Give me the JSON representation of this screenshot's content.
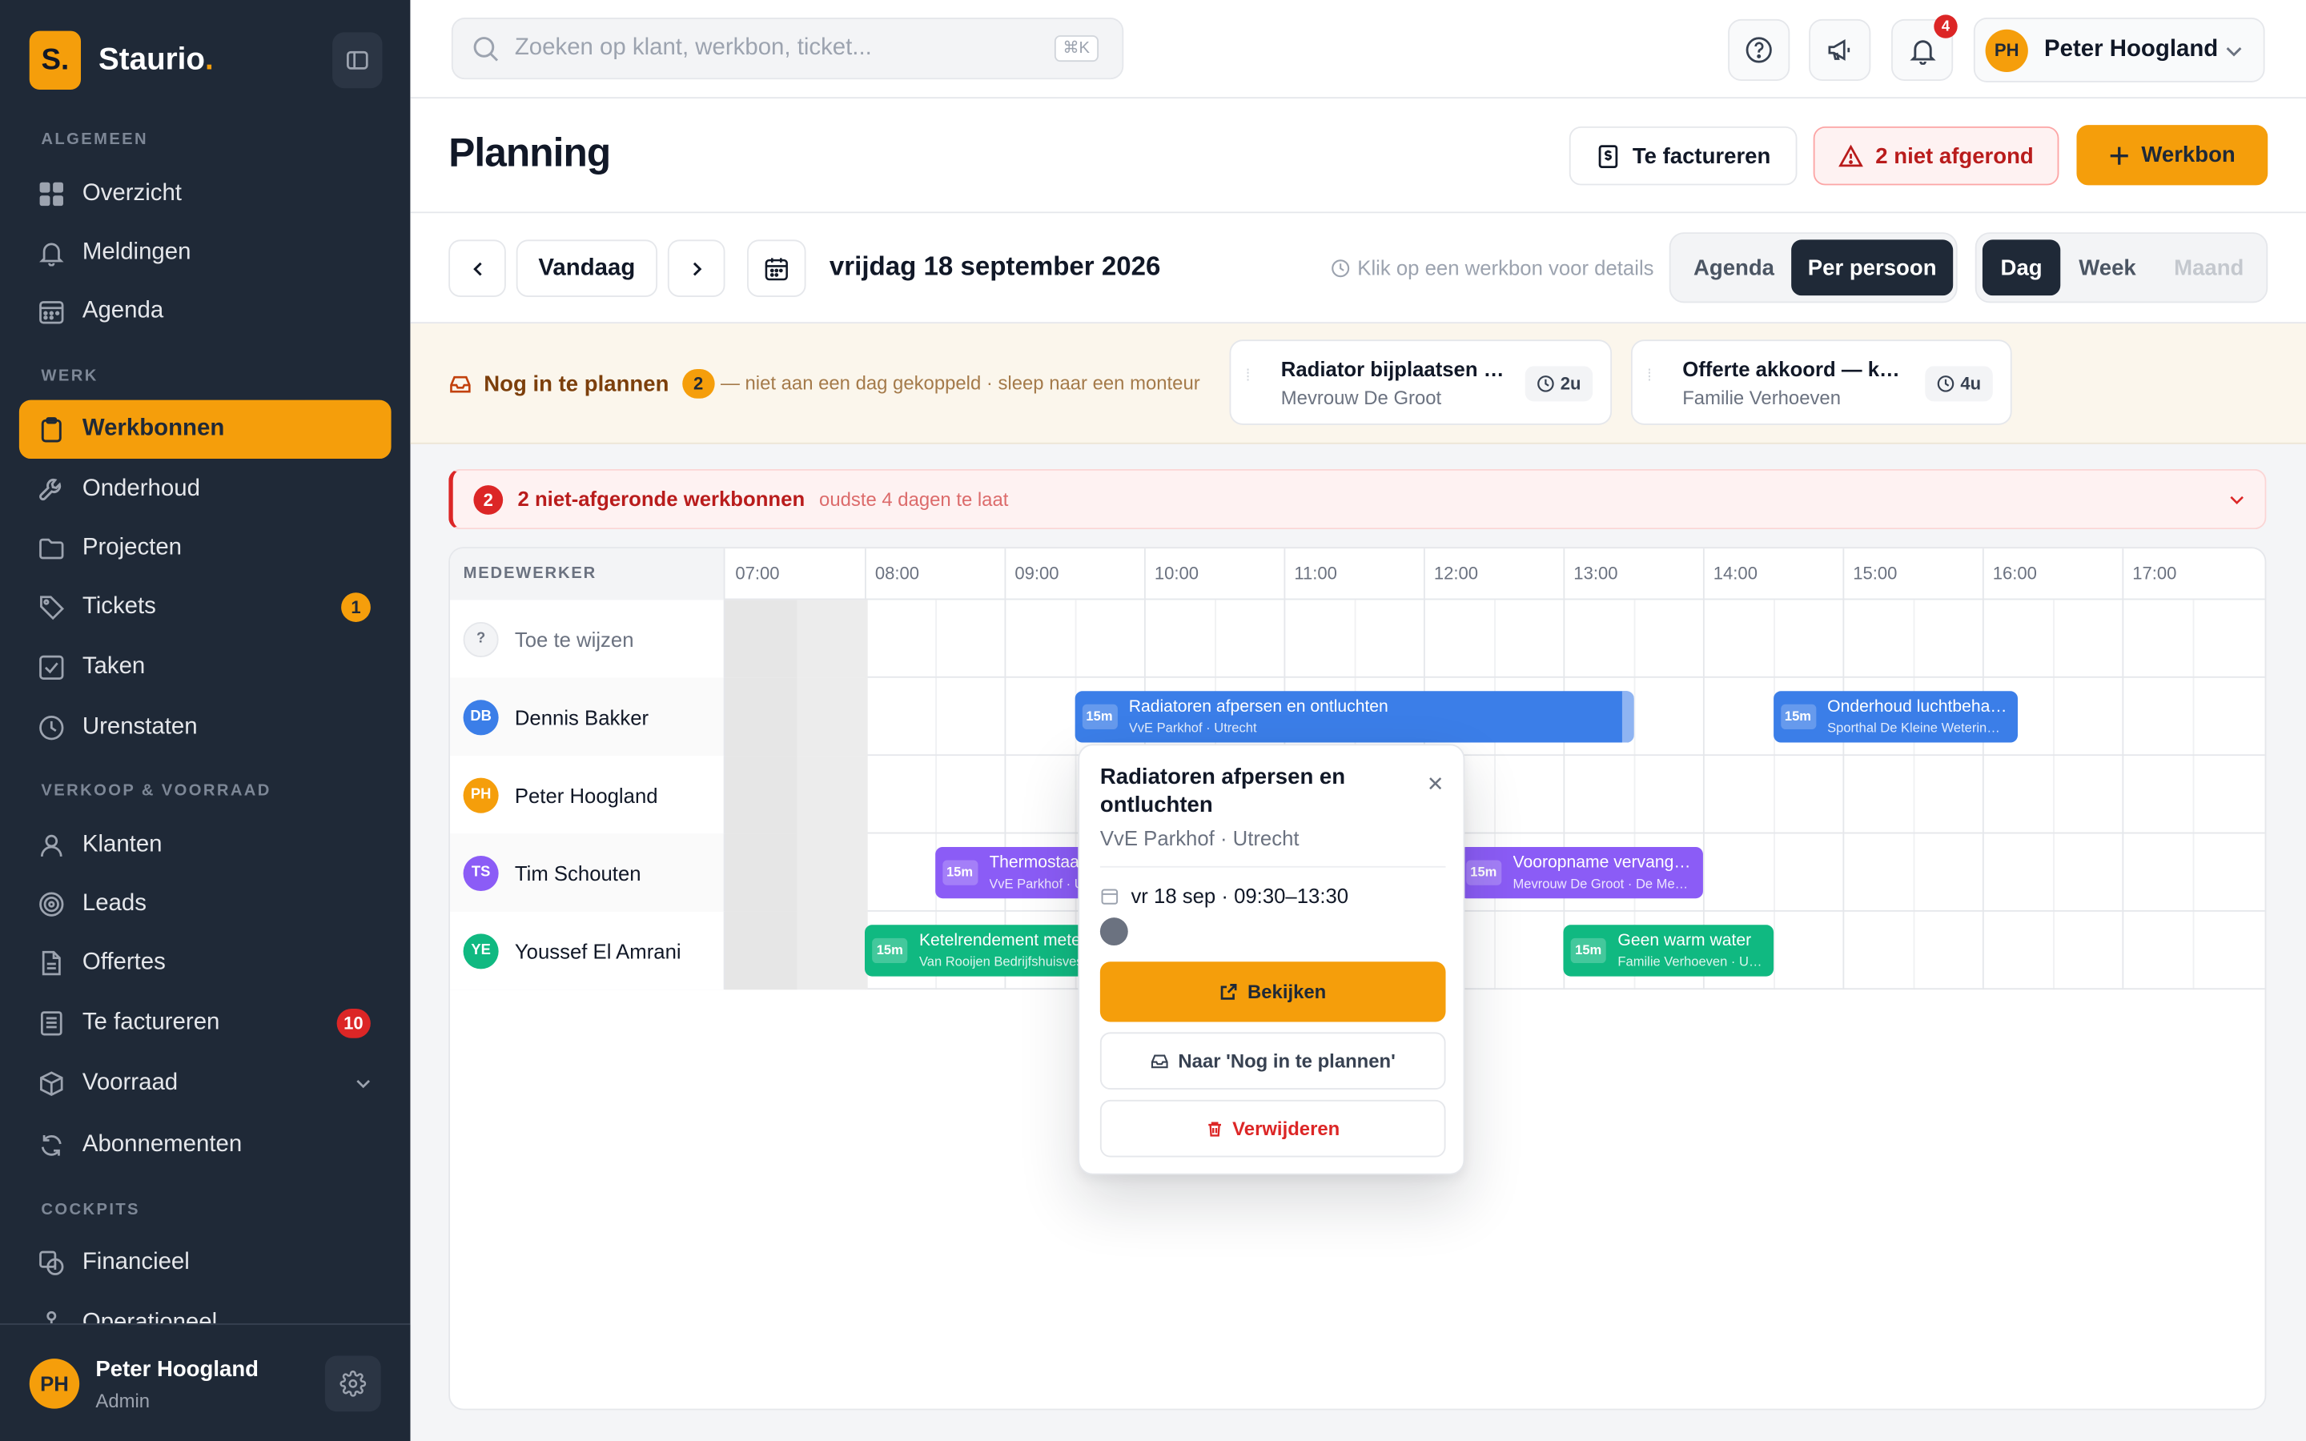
{
  "app": {
    "brand_letter": "S.",
    "brand_name": "Staurio",
    "brand_dot": "."
  },
  "sidebar": {
    "sections": [
      {
        "label": "ALGEMEEN"
      },
      {
        "label": "WERK"
      },
      {
        "label": "VERKOOP & VOORRAAD"
      },
      {
        "label": "COCKPITS"
      }
    ],
    "items": [
      {
        "label": "Overzicht",
        "icon": "grid-icon"
      },
      {
        "label": "Meldingen",
        "icon": "bell-icon"
      },
      {
        "label": "Agenda",
        "icon": "calendar-icon"
      },
      {
        "label": "Werkbonnen",
        "icon": "clipboard-icon",
        "active": true
      },
      {
        "label": "Onderhoud",
        "icon": "wrench-icon"
      },
      {
        "label": "Projecten",
        "icon": "folder-icon"
      },
      {
        "label": "Tickets",
        "icon": "tag-icon",
        "badge": "1"
      },
      {
        "label": "Taken",
        "icon": "checkbox-icon"
      },
      {
        "label": "Urenstaten",
        "icon": "clock-icon"
      },
      {
        "label": "Klanten",
        "icon": "user-icon"
      },
      {
        "label": "Leads",
        "icon": "target-icon"
      },
      {
        "label": "Offertes",
        "icon": "document-icon"
      },
      {
        "label": "Te factureren",
        "icon": "invoice-icon",
        "badge": "10"
      },
      {
        "label": "Voorraad",
        "icon": "box-icon"
      },
      {
        "label": "Abonnementen",
        "icon": "refresh-icon"
      },
      {
        "label": "Financieel",
        "icon": "finance-icon"
      },
      {
        "label": "Operationeel",
        "icon": "operations-icon"
      }
    ],
    "footer": {
      "initials": "PH",
      "name": "Peter Hoogland",
      "role": "Admin"
    }
  },
  "topbar": {
    "search_placeholder": "Zoeken op klant, werkbon, ticket...",
    "search_shortcut": "⌘K",
    "notification_count": "4",
    "user_initials": "PH",
    "user_name": "Peter Hoogland"
  },
  "header": {
    "title": "Planning",
    "invoice_button": "Te factureren",
    "incomplete_button": "2 niet afgerond",
    "new_button": "Werkbon"
  },
  "toolbar": {
    "today_button": "Vandaag",
    "current_date": "vrijdag 18 september 2026",
    "hint": "Klik op een werkbon voor details",
    "view_modes": [
      "Agenda",
      "Per persoon"
    ],
    "active_view_mode": "Per persoon",
    "ranges": [
      "Dag",
      "Week",
      "Maand"
    ],
    "active_range": "Dag",
    "disabled_range": "Maand"
  },
  "unplanned": {
    "title": "Nog in te plannen",
    "count": "2",
    "note": "— niet aan een dag gekoppeld · sleep naar een monteur",
    "cards": [
      {
        "title": "Radiator bijplaatsen woonkamer",
        "client": "Mevrouw De Groot",
        "duration": "2u"
      },
      {
        "title": "Offerte akkoord — keuken",
        "client": "Familie Verhoeven",
        "duration": "4u"
      }
    ]
  },
  "alert": {
    "count": "2",
    "title": "2 niet-afgeronde werkbonnen",
    "subtitle": "oudste 4 dagen te laat"
  },
  "schedule": {
    "employee_column": "MEDEWERKER",
    "hours": [
      "07:00",
      "08:00",
      "09:00",
      "10:00",
      "11:00",
      "12:00",
      "13:00",
      "14:00",
      "15:00",
      "16:00",
      "17:00"
    ],
    "rows": [
      {
        "initials": "?",
        "name": "Toe te wijzen",
        "color": "#f3f4f6",
        "text_color": "#6b7280",
        "placeholder": true
      },
      {
        "initials": "DB",
        "name": "Dennis Bakker",
        "color": "#3b7ee8"
      },
      {
        "initials": "PH",
        "name": "Peter Hoogland",
        "color": "#f59e0b"
      },
      {
        "initials": "TS",
        "name": "Tim Schouten",
        "color": "#8b5cf6"
      },
      {
        "initials": "YE",
        "name": "Youssef El Amrani",
        "color": "#10b981"
      }
    ],
    "events": [
      {
        "row": 1,
        "start": "09:30",
        "end": "13:30",
        "color": "#3b7ee8",
        "duration": "15m",
        "title": "Radiatoren afpersen en ontluchten",
        "subtitle": "VvE Parkhof · Utrecht",
        "selected": true
      },
      {
        "row": 1,
        "start": "14:30",
        "end": "16:15",
        "color": "#3b7ee8",
        "duration": "15m",
        "title": "Onderhoud luchtbehandeling",
        "subtitle": "Sporthal De Kleine Wetering · Vleuten"
      },
      {
        "row": 3,
        "start": "08:30",
        "end": "10:30",
        "color": "#8b5cf6",
        "duration": "15m",
        "title": "Thermostaat vervangen",
        "subtitle": "VvE Parkhof · Utrecht"
      },
      {
        "row": 3,
        "start": "12:15",
        "end": "14:00",
        "color": "#8b5cf6",
        "duration": "15m",
        "title": "Vooropname vervangen cv-ketel",
        "subtitle": "Mevrouw De Groot · De Meern"
      },
      {
        "row": 4,
        "start": "08:00",
        "end": "10:00",
        "color": "#10b981",
        "duration": "15m",
        "title": "Ketelrendement meten",
        "subtitle": "Van Rooijen Bedrijfshuisvesting"
      },
      {
        "row": 4,
        "start": "13:00",
        "end": "14:30",
        "color": "#10b981",
        "duration": "15m",
        "title": "Geen warm water",
        "subtitle": "Familie Verhoeven · Utrecht"
      }
    ]
  },
  "popover": {
    "title": "Radiatoren afpersen en ontluchten",
    "subtitle": "VvE Parkhof · Utrecht",
    "datetime": "vr 18 sep · 09:30–13:30",
    "view_button": "Bekijken",
    "unplan_button": "Naar 'Nog in te plannen'",
    "delete_button": "Verwijderen"
  }
}
